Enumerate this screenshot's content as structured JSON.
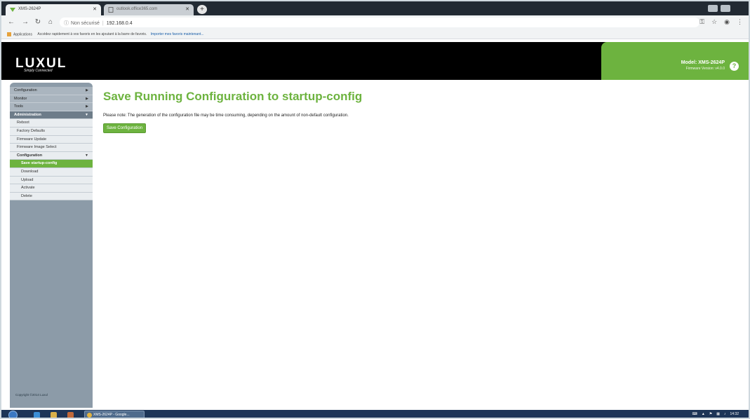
{
  "browser": {
    "tabs": [
      {
        "title": "XMS-2624P",
        "active": true
      },
      {
        "title": "outlook.office365.com",
        "active": false
      }
    ],
    "new_tab_glyph": "+",
    "address": {
      "security_label": "Non sécurisé",
      "url": "192.168.0.4"
    },
    "bookmarks": {
      "apps_label": "Applications",
      "hint_text": "Accédez rapidement à vos favoris en les ajoutant à la barre de favoris.",
      "import_link": "Importer mes favoris maintenant..."
    }
  },
  "header": {
    "logo_text": "LUXUL",
    "tagline": "Simply Connected",
    "model": "Model: XMS-2624P",
    "firmware": "Firmware Version: v4.0.0"
  },
  "sidebar": {
    "top_items": [
      {
        "label": "Configuration"
      },
      {
        "label": "Monitor"
      },
      {
        "label": "Tools"
      },
      {
        "label": "Administration"
      }
    ],
    "admin_items": [
      {
        "label": "Reboot"
      },
      {
        "label": "Factory Defaults"
      },
      {
        "label": "Firmware Update"
      },
      {
        "label": "Firmware Image Select"
      },
      {
        "label": "Configuration"
      }
    ],
    "config_items": [
      {
        "label": "Save startup-config",
        "active": true
      },
      {
        "label": "Download"
      },
      {
        "label": "Upload"
      },
      {
        "label": "Activate"
      },
      {
        "label": "Delete"
      }
    ],
    "copyright": "Copyright ©2014 Luxul"
  },
  "main": {
    "title": "Save Running Configuration to startup-config",
    "note": "Please note: The generation of the configuration file may be time consuming, depending on the amount of non-default configuration.",
    "save_button": "Save Configuration"
  },
  "taskbar": {
    "task_label": "XMS-2624P - Google...",
    "clock": "14:32"
  },
  "colors": {
    "brand_green": "#6db33f",
    "header_black": "#000000",
    "sidebar_gray": "#8c9ba8"
  }
}
